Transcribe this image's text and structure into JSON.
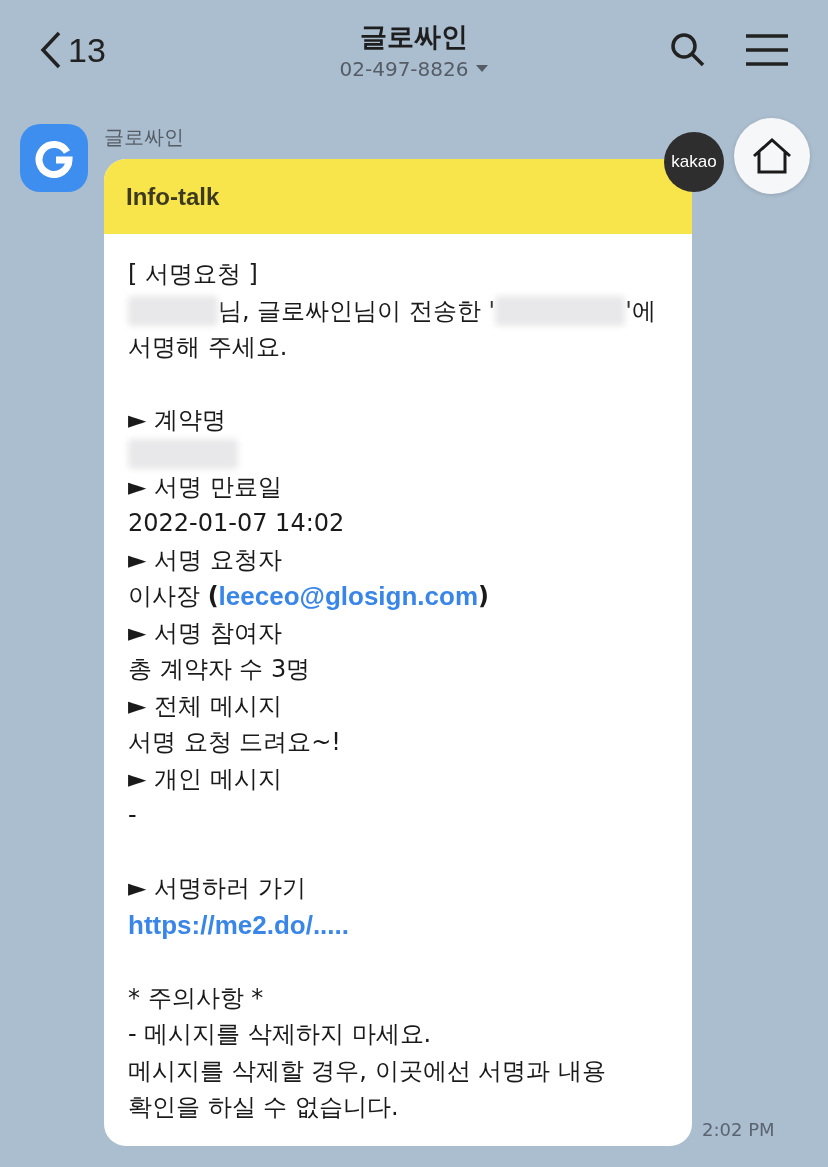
{
  "header": {
    "back_count": "13",
    "title": "글로싸인",
    "subtitle": "02-497-8826"
  },
  "message": {
    "sender": "글로싸인",
    "badge": "kakao",
    "card_title": "Info-talk",
    "time": "2:02 PM",
    "lines": [
      {
        "parts": [
          {
            "kind": "text",
            "text": "[ 서명요청 ]"
          }
        ]
      },
      {
        "parts": [
          {
            "kind": "redacted"
          },
          {
            "kind": "text",
            "text": "님, 글로싸인님이 전송한 '"
          },
          {
            "kind": "redacted"
          },
          {
            "kind": "text",
            "text": "'에"
          }
        ]
      },
      {
        "parts": [
          {
            "kind": "text",
            "text": "서명해 주세요."
          }
        ]
      },
      {
        "kind": "gap"
      },
      {
        "parts": [
          {
            "kind": "text",
            "text": "► 계약명"
          }
        ]
      },
      {
        "parts": [
          {
            "kind": "redacted"
          }
        ]
      },
      {
        "parts": [
          {
            "kind": "text",
            "text": "► 서명 만료일"
          }
        ]
      },
      {
        "parts": [
          {
            "kind": "text",
            "text": "2022-01-07 14:02"
          }
        ]
      },
      {
        "parts": [
          {
            "kind": "text",
            "text": "► 서명 요청자"
          }
        ]
      },
      {
        "parts": [
          {
            "kind": "text",
            "text": "이사장 **(**"
          },
          {
            "kind": "link",
            "text": "leeceo@glosign.com"
          },
          {
            "kind": "text",
            "text": "**)**"
          }
        ]
      },
      {
        "parts": [
          {
            "kind": "text",
            "text": "► 서명 참여자"
          }
        ]
      },
      {
        "parts": [
          {
            "kind": "text",
            "text": "총 계약자 수 3명"
          }
        ]
      },
      {
        "parts": [
          {
            "kind": "text",
            "text": "► 전체 메시지"
          }
        ]
      },
      {
        "parts": [
          {
            "kind": "text",
            "text": "서명 요청 드려요~!"
          }
        ]
      },
      {
        "parts": [
          {
            "kind": "text",
            "text": "► 개인 메시지"
          }
        ]
      },
      {
        "parts": [
          {
            "kind": "text",
            "text": "-"
          }
        ]
      },
      {
        "kind": "gap"
      },
      {
        "parts": [
          {
            "kind": "text",
            "text": "► 서명하러 가기"
          }
        ]
      },
      {
        "parts": [
          {
            "kind": "link",
            "text": "https://me2.do/....."
          }
        ]
      },
      {
        "kind": "gap"
      },
      {
        "parts": [
          {
            "kind": "text",
            "text": "* 주의사항 *"
          }
        ]
      },
      {
        "parts": [
          {
            "kind": "text",
            "text": "- 메시지를 삭제하지 마세요."
          }
        ]
      },
      {
        "parts": [
          {
            "kind": "text",
            "text": "메시지를 삭제할 경우, 이곳에선 서명과 내용"
          }
        ]
      },
      {
        "parts": [
          {
            "kind": "text",
            "text": "확인을 하실 수 없습니다."
          }
        ]
      }
    ]
  }
}
